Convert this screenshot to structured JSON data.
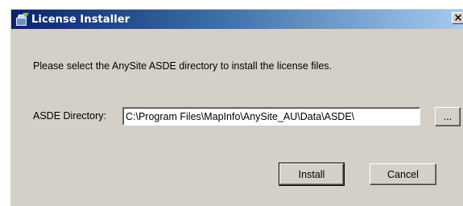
{
  "window": {
    "title": "License Installer",
    "app_icon": "installer-package-icon",
    "close_glyph": "×"
  },
  "content": {
    "prompt": "Please select the AnySite ASDE directory to install the license files.",
    "directory_label": "ASDE Directory:",
    "directory_value": "C:\\Program Files\\MapInfo\\AnySite_AU\\Data\\ASDE\\",
    "browse_label": "..."
  },
  "buttons": {
    "install_label": "Install",
    "cancel_label": "Cancel"
  }
}
